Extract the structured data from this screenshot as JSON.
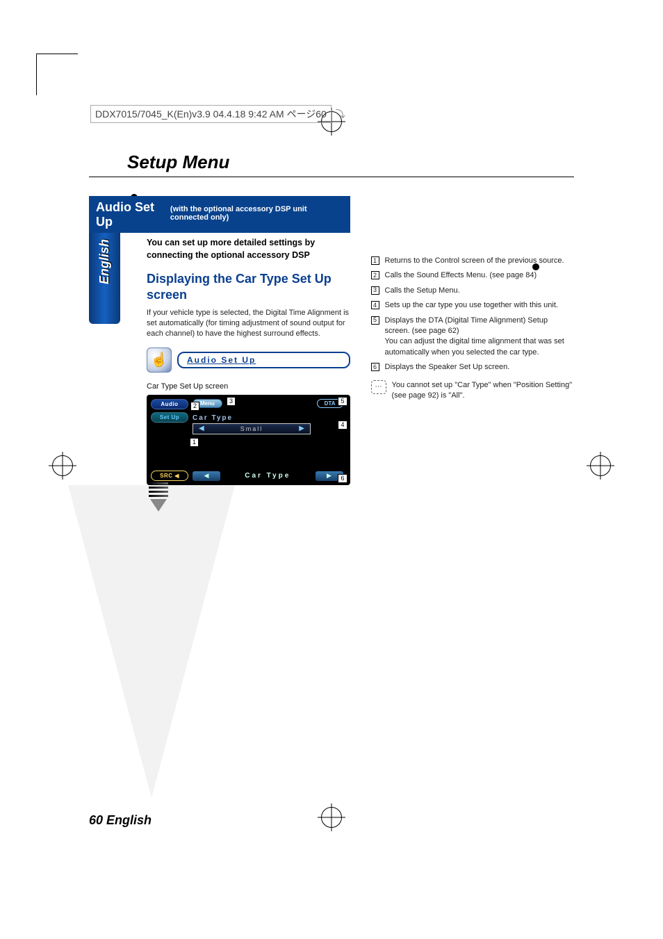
{
  "print_header": "DDX7015/7045_K(En)v3.9  04.4.18  9:42 AM  ページ60",
  "sidebar_label": "English",
  "title": "Setup Menu",
  "section_bar_big": "Audio Set Up",
  "section_bar_small": "(with the optional accessory DSP unit connected only)",
  "section_sub": "You can set up more detailed settings by connecting the optional accessory DSP",
  "sub_heading": "Displaying the Car Type Set Up screen",
  "body_text": "If your vehicle type is selected, the Digital Time Alignment is set automatically (for timing adjustment of sound output for each channel) to have the highest surround effects.",
  "audio_button_label": "Audio Set Up",
  "screen_label": "Car Type Set Up screen",
  "screenshot": {
    "side_audio": "Audio",
    "side_setup": "Set Up",
    "side_src": "SRC ◀",
    "menu": "Menu",
    "dta": "DTA",
    "car_type_label": "Car Type",
    "car_type_value": "Small",
    "bottom_label": "Car Type"
  },
  "callouts": {
    "c1": "1",
    "c2": "2",
    "c3": "3",
    "c4": "4",
    "c5": "5",
    "c6": "6"
  },
  "defs": {
    "d1": "Returns to the Control screen of the previous source.",
    "d2": "Calls the Sound Effects Menu. (see page 84)",
    "d3": "Calls the Setup Menu.",
    "d4": "Sets up the car type you use together with this unit.",
    "d5a": "Displays the DTA (Digital Time Alignment) Setup screen. (see page 62)",
    "d5b": "You can adjust the digital time alignment that was set automatically when you selected the car type.",
    "d6": "Displays the Speaker Set Up screen."
  },
  "note": "You cannot set up \"Car Type\" when \"Position Setting\" (see page 92) is \"All\".",
  "footer": "60 English"
}
